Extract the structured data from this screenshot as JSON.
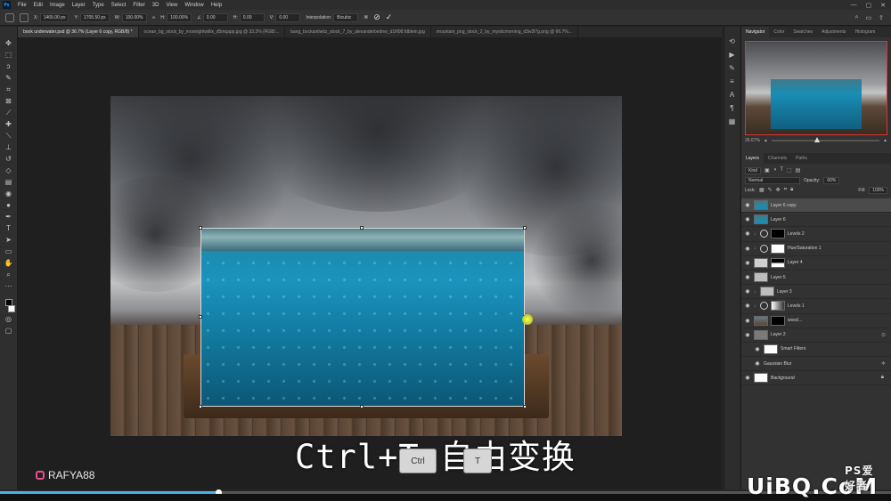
{
  "menubar": {
    "logo": "Ps",
    "items": [
      "File",
      "Edit",
      "Image",
      "Layer",
      "Type",
      "Select",
      "Filter",
      "3D",
      "View",
      "Window",
      "Help"
    ],
    "controls": [
      "—",
      "▢",
      "✕"
    ]
  },
  "options": {
    "x_label": "X:",
    "x_value": "1465.00 px",
    "y_label": "Y:",
    "y_value": "1705.50 px",
    "w_label": "W:",
    "w_value": "100.00%",
    "h_label": "H:",
    "h_value": "100.00%",
    "angle_value": "0.00",
    "h_skew_label": "H:",
    "h_skew_value": "0.00",
    "v_skew_label": "V:",
    "v_skew_value": "0.00",
    "interp_label": "Interpolation:",
    "interp_value": "Bicubic"
  },
  "tabs": [
    {
      "label": "book underwater.psd @ 36.7% (Layer 6 copy, RGB/8) *",
      "active": true
    },
    {
      "label": "ocean_bg_stock_by_moonightwillix_d5mqapp.jpg @ 33.3% (RGB/...",
      "active": false
    },
    {
      "label": "bang_bockantiwitz_stock_7_by_alexanderbednw_d1lfi08.fdbtein.jpg",
      "active": false
    },
    {
      "label": "mountain_png_stock_2_by_mysticmorning_d3w3l7g.png @ 66.7%...",
      "active": false
    }
  ],
  "panels": {
    "nav_tabs": [
      "Navigator",
      "Color",
      "Swatches",
      "Adjustments",
      "Histogram"
    ],
    "nav_zoom": "36.67%",
    "layer_tabs": [
      "Layers",
      "Channels",
      "Paths"
    ],
    "filter_kind": "Kind",
    "blend_mode": "Normal",
    "opacity_label": "Opacity:",
    "opacity_value": "60%",
    "lock_label": "Lock:",
    "fill_label": "Fill:",
    "fill_value": "100%"
  },
  "layers": [
    {
      "name": "Layer 6 copy",
      "selected": true
    },
    {
      "name": "Layer 6"
    },
    {
      "name": "Levels 2"
    },
    {
      "name": "Hue/Saturation 1"
    },
    {
      "name": "Layer 4"
    },
    {
      "name": "Layer 5"
    },
    {
      "name": "Layer 3"
    },
    {
      "name": "Levels 1"
    },
    {
      "name": "wood..."
    },
    {
      "name": "Layer 2"
    },
    {
      "name": "Smart Filters"
    },
    {
      "name": "Gaussian Blur"
    },
    {
      "name": "Background"
    }
  ],
  "video": {
    "progress": 0.245,
    "subtitle": "Ctrl+T 自由变换",
    "key_ctrl": "Ctrl",
    "key_t": "T",
    "watermark": "RAFYA88",
    "site_logo": "UiBQ.CoM",
    "site_ps": "PS爱好者"
  },
  "colors": {
    "progress": "#4ab0e8",
    "accent": "#31a8ff"
  }
}
